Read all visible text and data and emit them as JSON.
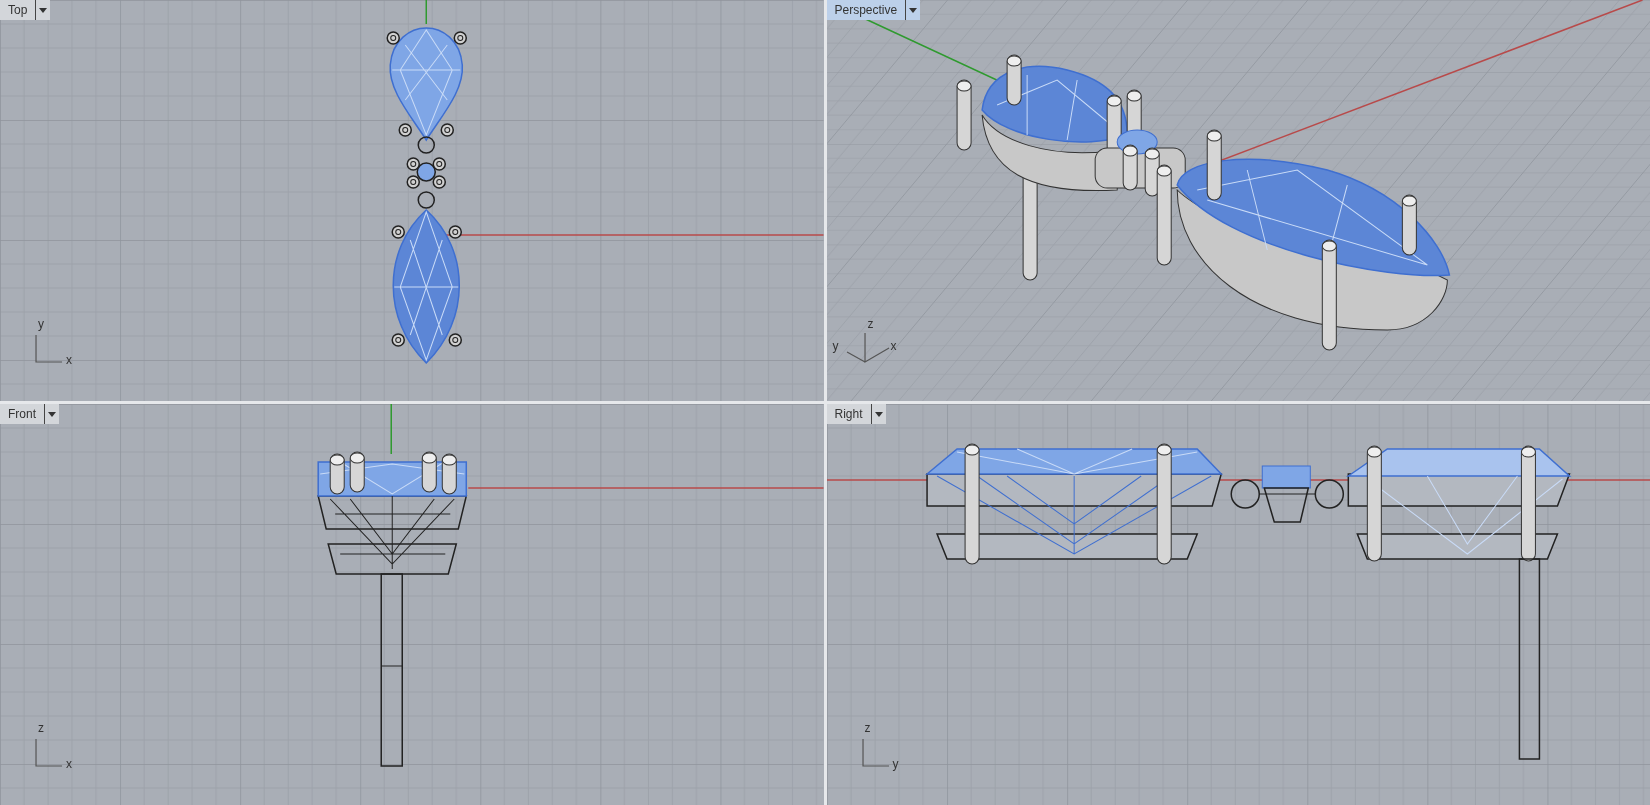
{
  "viewports": [
    {
      "kind": "top",
      "title": "Top",
      "selected": false,
      "axes": [
        "y",
        "x"
      ]
    },
    {
      "kind": "perspective",
      "title": "Perspective",
      "selected": true,
      "axes": [
        "z",
        "y",
        "x"
      ]
    },
    {
      "kind": "front",
      "title": "Front",
      "selected": false,
      "axes": [
        "z",
        "x"
      ]
    },
    {
      "kind": "right",
      "title": "Right",
      "selected": false,
      "axes": [
        "z",
        "y"
      ]
    }
  ]
}
